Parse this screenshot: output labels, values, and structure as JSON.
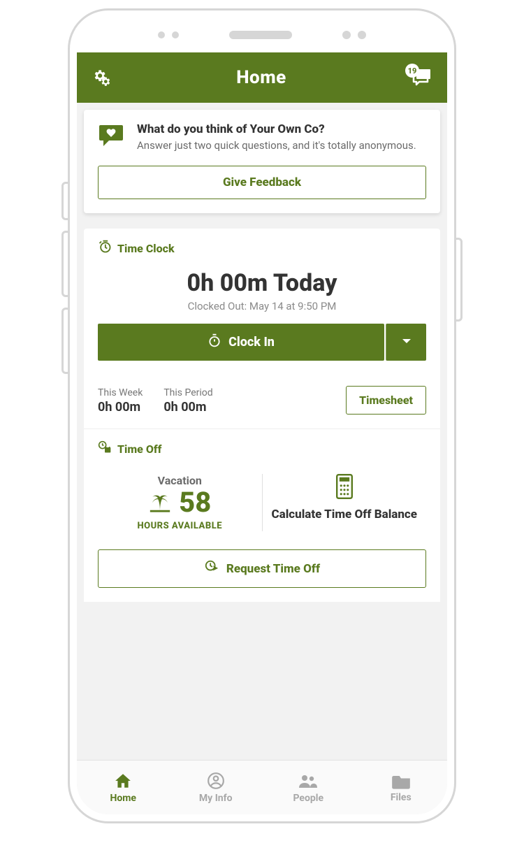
{
  "header": {
    "title": "Home",
    "inbox_badge": "19"
  },
  "feedback": {
    "title": "What do you think of Your Own Co?",
    "subtitle": "Answer just two quick questions, and it's totally anonymous.",
    "button": "Give Feedback"
  },
  "time_clock": {
    "section_title": "Time Clock",
    "today_display": "0h 00m Today",
    "status_line": "Clocked Out: May 14 at 9:50 PM",
    "clock_in_label": "Clock In",
    "this_week_label": "This Week",
    "this_week_value": "0h 00m",
    "this_period_label": "This Period",
    "this_period_value": "0h 00m",
    "timesheet_label": "Timesheet"
  },
  "time_off": {
    "section_title": "Time Off",
    "vacation_label": "Vacation",
    "vacation_hours": "58",
    "vacation_sub": "HOURS AVAILABLE",
    "calc_label": "Calculate Time Off Balance",
    "request_label": "Request Time Off"
  },
  "nav": {
    "home": "Home",
    "myinfo": "My Info",
    "people": "People",
    "files": "Files"
  }
}
